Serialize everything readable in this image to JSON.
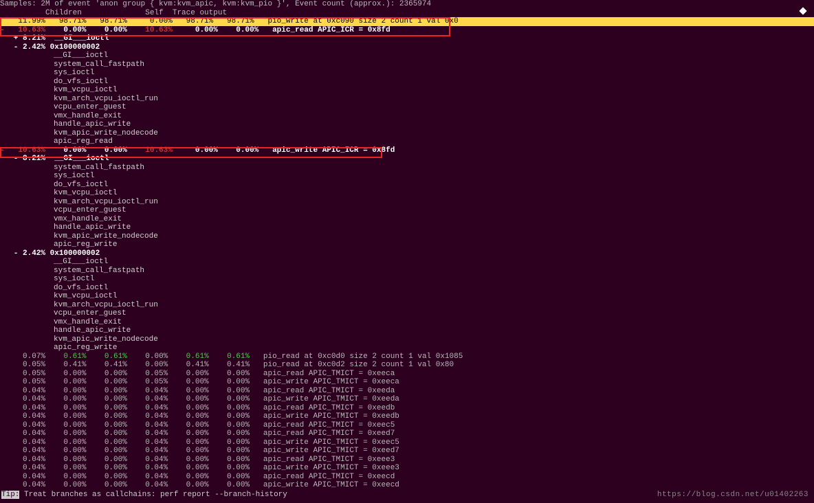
{
  "header": {
    "samples": "Samples: 2M of event 'anon group { kvm:kvm_apic, kvm:kvm_pio }', Event count (approx.): 2365974",
    "cols": "          Children              Self  Trace output"
  },
  "rows": {
    "r0": "    11.99%   98.71%   98.71%     0.00%   98.71%   98.71%   pio_write at 0xc090 size 2 count 1 val 0x0",
    "r1r": "-   10.63%",
    "r1m": "    0.00%    0.00%",
    "r1r2": "    10.63%",
    "r1e": "     0.00%    0.00%   apic_read APIC_ICR = 0x8fd",
    "r2": "   + 8.21%  __GI___ioctl",
    "r3": "   - 2.42% 0x100000002",
    "calls1": [
      "__GI___ioctl",
      "system_call_fastpath",
      "sys_ioctl",
      "do_vfs_ioctl",
      "kvm_vcpu_ioctl",
      "kvm_arch_vcpu_ioctl_run",
      "vcpu_enter_guest",
      "vmx_handle_exit",
      "handle_apic_write",
      "kvm_apic_write_nodecode",
      "apic_reg_read"
    ],
    "r4r": "-   10.63%",
    "r4m": "    0.00%    0.00%",
    "r4r2": "    10.63%",
    "r4e": "     0.00%    0.00%   apic_write APIC_ICR = 0x8fd",
    "r5": "   - 8.21%  __GI___ioctl",
    "calls2": [
      "system_call_fastpath",
      "sys_ioctl",
      "do_vfs_ioctl",
      "kvm_vcpu_ioctl",
      "kvm_arch_vcpu_ioctl_run",
      "vcpu_enter_guest",
      "vmx_handle_exit",
      "handle_apic_write",
      "kvm_apic_write_nodecode",
      "apic_reg_write"
    ],
    "r6": "   - 2.42% 0x100000002",
    "calls3": [
      "__GI___ioctl",
      "system_call_fastpath",
      "sys_ioctl",
      "do_vfs_ioctl",
      "kvm_vcpu_ioctl",
      "kvm_arch_vcpu_ioctl_run",
      "vcpu_enter_guest",
      "vmx_handle_exit",
      "handle_apic_write",
      "kvm_apic_write_nodecode",
      "apic_reg_write"
    ],
    "tail": [
      {
        "c": [
          "0.07%",
          "0.61%",
          "0.61%",
          "0.00%",
          "0.61%",
          "0.61%"
        ],
        "g": [
          1,
          2,
          4,
          5
        ],
        "t": "pio_read at 0xc0d0 size 2 count 1 val 0x1085"
      },
      {
        "c": [
          "0.05%",
          "0.41%",
          "0.41%",
          "0.00%",
          "0.41%",
          "0.41%"
        ],
        "g": [],
        "t": "pio_read at 0xc0d2 size 2 count 1 val 0x80"
      },
      {
        "c": [
          "0.05%",
          "0.00%",
          "0.00%",
          "0.05%",
          "0.00%",
          "0.00%"
        ],
        "g": [],
        "t": "apic_read APIC_TMICT = 0xeeca"
      },
      {
        "c": [
          "0.05%",
          "0.00%",
          "0.00%",
          "0.05%",
          "0.00%",
          "0.00%"
        ],
        "g": [],
        "t": "apic_write APIC_TMICT = 0xeeca"
      },
      {
        "c": [
          "0.04%",
          "0.00%",
          "0.00%",
          "0.04%",
          "0.00%",
          "0.00%"
        ],
        "g": [],
        "t": "apic_read APIC_TMICT = 0xeeda"
      },
      {
        "c": [
          "0.04%",
          "0.00%",
          "0.00%",
          "0.04%",
          "0.00%",
          "0.00%"
        ],
        "g": [],
        "t": "apic_write APIC_TMICT = 0xeeda"
      },
      {
        "c": [
          "0.04%",
          "0.00%",
          "0.00%",
          "0.04%",
          "0.00%",
          "0.00%"
        ],
        "g": [],
        "t": "apic_read APIC_TMICT = 0xeedb"
      },
      {
        "c": [
          "0.04%",
          "0.00%",
          "0.00%",
          "0.04%",
          "0.00%",
          "0.00%"
        ],
        "g": [],
        "t": "apic_write APIC_TMICT = 0xeedb"
      },
      {
        "c": [
          "0.04%",
          "0.00%",
          "0.00%",
          "0.04%",
          "0.00%",
          "0.00%"
        ],
        "g": [],
        "t": "apic_read APIC_TMICT = 0xeec5"
      },
      {
        "c": [
          "0.04%",
          "0.00%",
          "0.00%",
          "0.04%",
          "0.00%",
          "0.00%"
        ],
        "g": [],
        "t": "apic_read APIC_TMICT = 0xeed7"
      },
      {
        "c": [
          "0.04%",
          "0.00%",
          "0.00%",
          "0.04%",
          "0.00%",
          "0.00%"
        ],
        "g": [],
        "t": "apic_write APIC_TMICT = 0xeec5"
      },
      {
        "c": [
          "0.04%",
          "0.00%",
          "0.00%",
          "0.04%",
          "0.00%",
          "0.00%"
        ],
        "g": [],
        "t": "apic_write APIC_TMICT = 0xeed7"
      },
      {
        "c": [
          "0.04%",
          "0.00%",
          "0.00%",
          "0.04%",
          "0.00%",
          "0.00%"
        ],
        "g": [],
        "t": "apic_read APIC_TMICT = 0xeee3"
      },
      {
        "c": [
          "0.04%",
          "0.00%",
          "0.00%",
          "0.04%",
          "0.00%",
          "0.00%"
        ],
        "g": [],
        "t": "apic_write APIC_TMICT = 0xeee3"
      },
      {
        "c": [
          "0.04%",
          "0.00%",
          "0.00%",
          "0.04%",
          "0.00%",
          "0.00%"
        ],
        "g": [],
        "t": "apic_read APIC_TMICT = 0xeecd"
      },
      {
        "c": [
          "0.04%",
          "0.00%",
          "0.00%",
          "0.04%",
          "0.00%",
          "0.00%"
        ],
        "g": [],
        "t": "apic_write APIC_TMICT = 0xeecd"
      }
    ]
  },
  "tip": {
    "label": "Tip:",
    "text": " Treat branches as callchains: perf report --branch-history"
  },
  "watermark": "https://blog.csdn.net/u01402263"
}
